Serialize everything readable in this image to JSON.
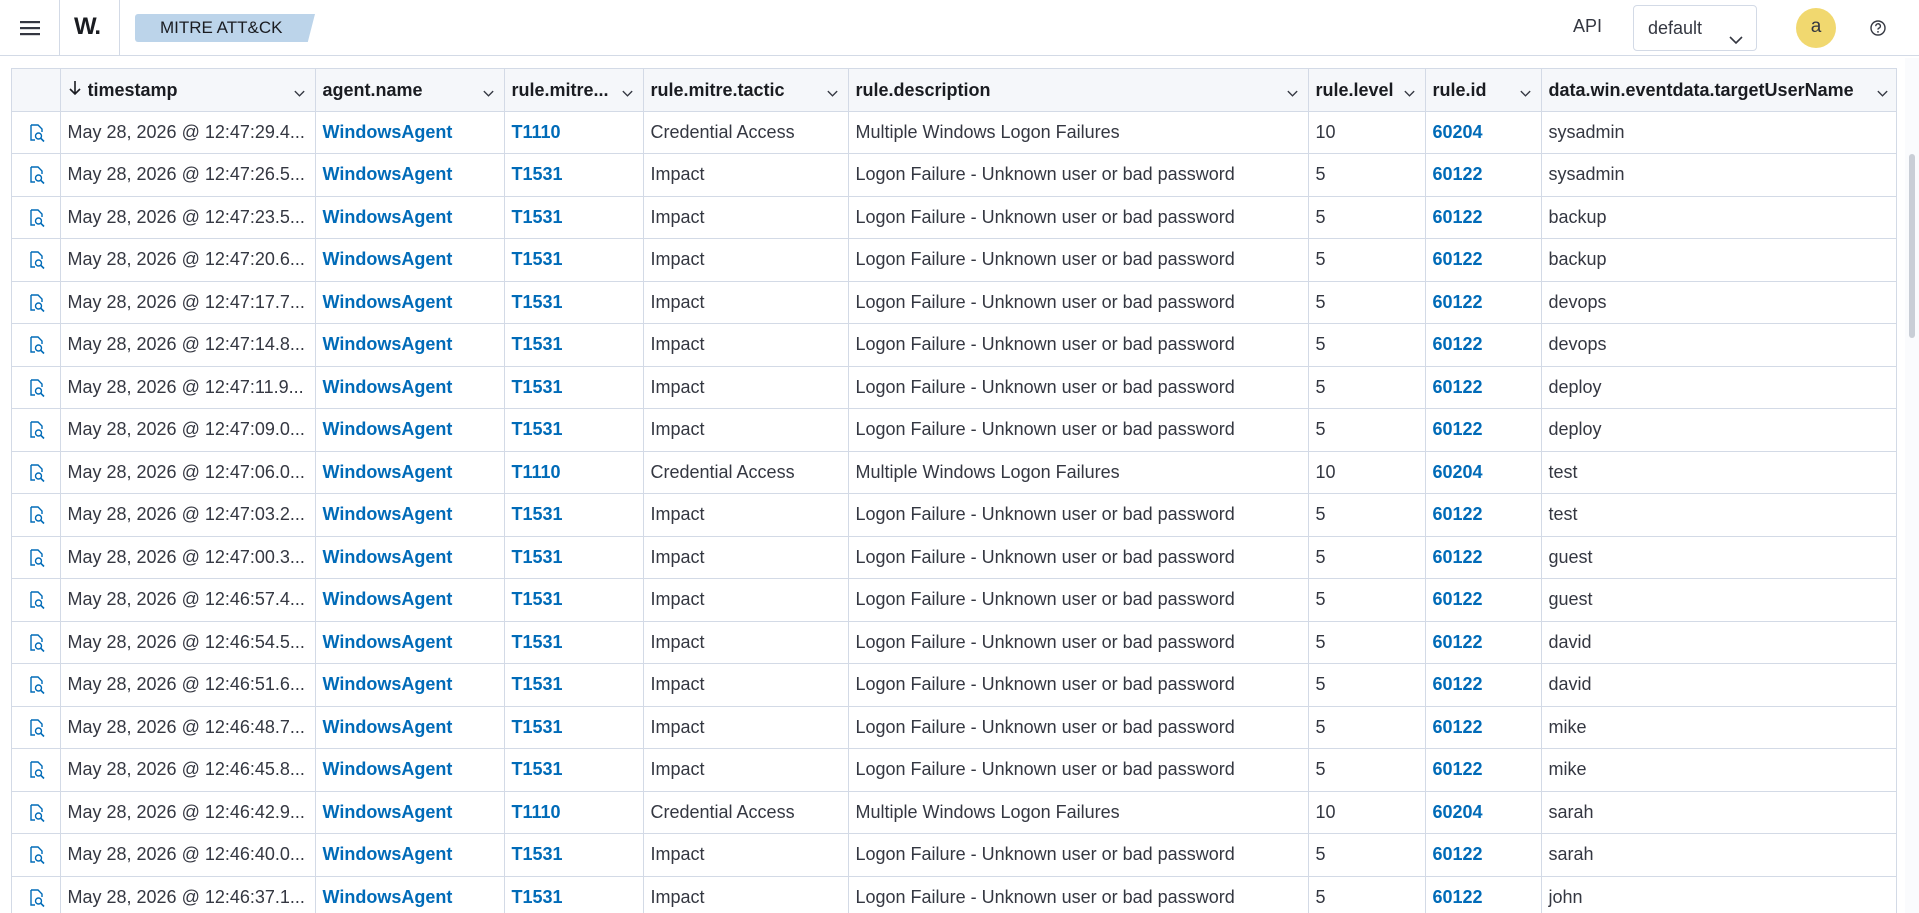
{
  "header": {
    "logo_text": "W",
    "logo_dot": ".",
    "breadcrumb": "MITRE ATT&CK",
    "api_label": "API",
    "space_selected": "default",
    "avatar_letter": "a"
  },
  "table": {
    "columns": [
      {
        "key": "timestamp",
        "label": "timestamp",
        "sorted": "desc"
      },
      {
        "key": "agent",
        "label": "agent.name"
      },
      {
        "key": "mitre_id",
        "label": "rule.mitre..."
      },
      {
        "key": "tactic",
        "label": "rule.mitre.tactic"
      },
      {
        "key": "description",
        "label": "rule.description"
      },
      {
        "key": "level",
        "label": "rule.level"
      },
      {
        "key": "rule_id",
        "label": "rule.id"
      },
      {
        "key": "user",
        "label": "data.win.eventdata.targetUserName"
      }
    ],
    "rows": [
      [
        "May 28, 2026 @ 12:47:29.4...",
        "WindowsAgent",
        "T1110",
        "Credential Access",
        "Multiple Windows Logon Failures",
        "10",
        "60204",
        "sysadmin"
      ],
      [
        "May 28, 2026 @ 12:47:26.5...",
        "WindowsAgent",
        "T1531",
        "Impact",
        "Logon Failure - Unknown user or bad password",
        "5",
        "60122",
        "sysadmin"
      ],
      [
        "May 28, 2026 @ 12:47:23.5...",
        "WindowsAgent",
        "T1531",
        "Impact",
        "Logon Failure - Unknown user or bad password",
        "5",
        "60122",
        "backup"
      ],
      [
        "May 28, 2026 @ 12:47:20.6...",
        "WindowsAgent",
        "T1531",
        "Impact",
        "Logon Failure - Unknown user or bad password",
        "5",
        "60122",
        "backup"
      ],
      [
        "May 28, 2026 @ 12:47:17.7...",
        "WindowsAgent",
        "T1531",
        "Impact",
        "Logon Failure - Unknown user or bad password",
        "5",
        "60122",
        "devops"
      ],
      [
        "May 28, 2026 @ 12:47:14.8...",
        "WindowsAgent",
        "T1531",
        "Impact",
        "Logon Failure - Unknown user or bad password",
        "5",
        "60122",
        "devops"
      ],
      [
        "May 28, 2026 @ 12:47:11.9...",
        "WindowsAgent",
        "T1531",
        "Impact",
        "Logon Failure - Unknown user or bad password",
        "5",
        "60122",
        "deploy"
      ],
      [
        "May 28, 2026 @ 12:47:09.0...",
        "WindowsAgent",
        "T1531",
        "Impact",
        "Logon Failure - Unknown user or bad password",
        "5",
        "60122",
        "deploy"
      ],
      [
        "May 28, 2026 @ 12:47:06.0...",
        "WindowsAgent",
        "T1110",
        "Credential Access",
        "Multiple Windows Logon Failures",
        "10",
        "60204",
        "test"
      ],
      [
        "May 28, 2026 @ 12:47:03.2...",
        "WindowsAgent",
        "T1531",
        "Impact",
        "Logon Failure - Unknown user or bad password",
        "5",
        "60122",
        "test"
      ],
      [
        "May 28, 2026 @ 12:47:00.3...",
        "WindowsAgent",
        "T1531",
        "Impact",
        "Logon Failure - Unknown user or bad password",
        "5",
        "60122",
        "guest"
      ],
      [
        "May 28, 2026 @ 12:46:57.4...",
        "WindowsAgent",
        "T1531",
        "Impact",
        "Logon Failure - Unknown user or bad password",
        "5",
        "60122",
        "guest"
      ],
      [
        "May 28, 2026 @ 12:46:54.5...",
        "WindowsAgent",
        "T1531",
        "Impact",
        "Logon Failure - Unknown user or bad password",
        "5",
        "60122",
        "david"
      ],
      [
        "May 28, 2026 @ 12:46:51.6...",
        "WindowsAgent",
        "T1531",
        "Impact",
        "Logon Failure - Unknown user or bad password",
        "5",
        "60122",
        "david"
      ],
      [
        "May 28, 2026 @ 12:46:48.7...",
        "WindowsAgent",
        "T1531",
        "Impact",
        "Logon Failure - Unknown user or bad password",
        "5",
        "60122",
        "mike"
      ],
      [
        "May 28, 2026 @ 12:46:45.8...",
        "WindowsAgent",
        "T1531",
        "Impact",
        "Logon Failure - Unknown user or bad password",
        "5",
        "60122",
        "mike"
      ],
      [
        "May 28, 2026 @ 12:46:42.9...",
        "WindowsAgent",
        "T1110",
        "Credential Access",
        "Multiple Windows Logon Failures",
        "10",
        "60204",
        "sarah"
      ],
      [
        "May 28, 2026 @ 12:46:40.0...",
        "WindowsAgent",
        "T1531",
        "Impact",
        "Logon Failure - Unknown user or bad password",
        "5",
        "60122",
        "sarah"
      ],
      [
        "May 28, 2026 @ 12:46:37.1...",
        "WindowsAgent",
        "T1531",
        "Impact",
        "Logon Failure - Unknown user or bad password",
        "5",
        "60122",
        "john"
      ]
    ]
  },
  "colors": {
    "link": "#006bb8",
    "breadcrumb_bg": "#bcd4ea",
    "avatar_bg": "#f1d86f",
    "border": "#d3dae6"
  },
  "icons": {
    "menu": "hamburger-menu-icon",
    "inspect": "inspect-document-icon",
    "help": "help-icon",
    "chevron": "chevron-down-icon",
    "sort": "sort-descending-icon"
  }
}
